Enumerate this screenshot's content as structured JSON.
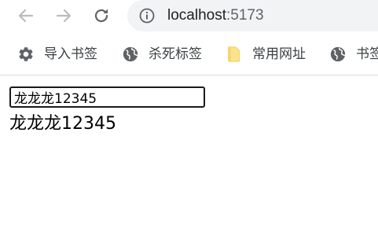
{
  "browser": {
    "url_host": "localhost",
    "url_port": ":5173",
    "icons": {
      "back": "arrow-left-icon",
      "forward": "arrow-right-icon",
      "reload": "reload-icon",
      "site_info": "info-icon"
    },
    "colors": {
      "toolbar_bg": "#ffffff",
      "omnibox_bg": "#f1f3f4",
      "icon_gray": "#5f6368",
      "disabled_gray": "#babcbe"
    }
  },
  "bookmarks": [
    {
      "label": "导入书签",
      "icon": "gear-icon"
    },
    {
      "label": "杀死标签",
      "icon": "globe-icon"
    },
    {
      "label": "常用网址",
      "icon": "folder-icon"
    },
    {
      "label": "书签",
      "icon": "globe-icon"
    }
  ],
  "page": {
    "input_value": "龙龙龙12345",
    "echo_text": "龙龙龙12345"
  }
}
